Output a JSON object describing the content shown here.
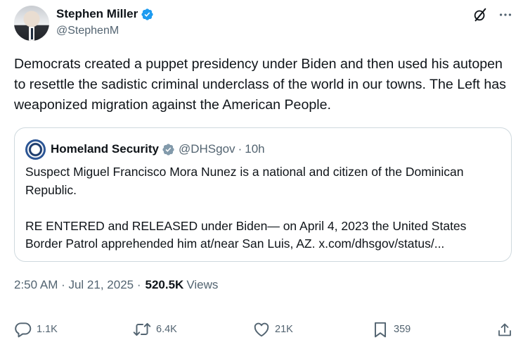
{
  "author": {
    "name": "Stephen Miller",
    "handle": "@StephenM"
  },
  "tweet": {
    "text": "Democrats created a puppet presidency under Biden and then used his autopen to resettle the sadistic criminal underclass of the world in our towns. The Left has weaponized migration against the American People."
  },
  "quote": {
    "name": "Homeland Security",
    "handle": "@DHSgov",
    "separator": "·",
    "time": "10h",
    "text": "Suspect Miguel Francisco Mora Nunez is a national and citizen of the Dominican Republic.\n\nRE ENTERED and RELEASED under Biden— on April 4, 2023 the United States Border Patrol apprehended him at/near San Luis, AZ. x.com/dhsgov/status/..."
  },
  "timestamp": {
    "text": "2:50 AM · Jul 21, 2025 ·",
    "views_count": "520.5K",
    "views_label": "Views"
  },
  "actions": {
    "replies": "1.1K",
    "reposts": "6.4K",
    "likes": "21K",
    "bookmarks": "359"
  },
  "colors": {
    "verified_blue": "#1d9bf0",
    "government_gray": "#829aab",
    "muted_text": "#536471",
    "border": "#cfd9de"
  },
  "icons": [
    "verified-badge-icon",
    "grok-icon",
    "more-icon",
    "reply-icon",
    "retweet-icon",
    "like-icon",
    "bookmark-icon",
    "share-icon"
  ]
}
